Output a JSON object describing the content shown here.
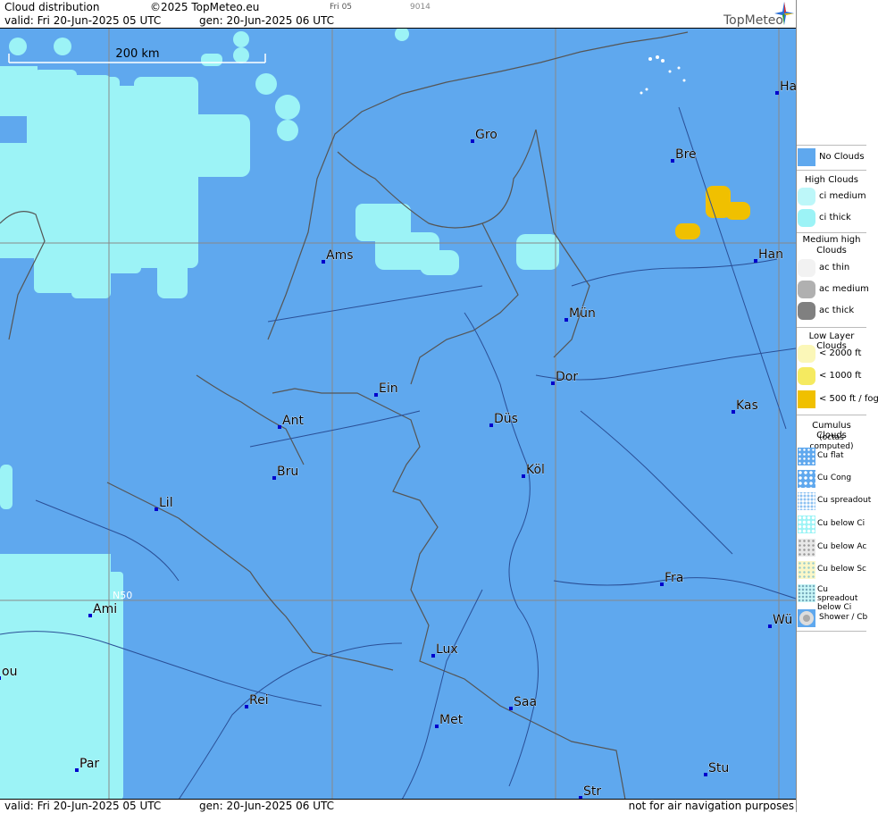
{
  "header": {
    "title": "Cloud distribution",
    "copyright": "©2025 TopMeteo.eu",
    "valid": "valid:  Fri  20-Jun-2025  05 UTC",
    "gen": "gen: 20-Jun-2025 06 UTC",
    "small1": "Fri 05",
    "small2": "9014",
    "brand": "TopMeteo"
  },
  "footer": {
    "valid": "valid:  Fri  20-Jun-2025  05 UTC",
    "gen": "gen: 20-Jun-2025 06 UTC",
    "note": "not for air navigation purposes"
  },
  "map": {
    "scale_label": "200 km",
    "lat_label": "N50",
    "colors": {
      "no_clouds": "#5fa8ee",
      "ci": "#9cf3f6",
      "low_fog": "#f0c000",
      "river": "#2a4f96",
      "grid": "#888888"
    },
    "cities": [
      {
        "name": "Ha"
      },
      {
        "name": "Gro"
      },
      {
        "name": "Bre"
      },
      {
        "name": "Ams"
      },
      {
        "name": "Han"
      },
      {
        "name": "Mün"
      },
      {
        "name": "Ein"
      },
      {
        "name": "Dor"
      },
      {
        "name": "Ant"
      },
      {
        "name": "Düs"
      },
      {
        "name": "Kas"
      },
      {
        "name": "Köl"
      },
      {
        "name": "Bru"
      },
      {
        "name": "Lil"
      },
      {
        "name": "Fra"
      },
      {
        "name": "Ami"
      },
      {
        "name": "Wü"
      },
      {
        "name": "Lux"
      },
      {
        "name": "ou"
      },
      {
        "name": "Rei"
      },
      {
        "name": "Saa"
      },
      {
        "name": "Met"
      },
      {
        "name": "Par"
      },
      {
        "name": "Stu"
      },
      {
        "name": "Str"
      }
    ]
  },
  "legend": {
    "no_clouds": "No Clouds",
    "high_title": "High Clouds",
    "ci_medium": "ci medium",
    "ci_thick": "ci thick",
    "medium_title": "Medium high Clouds",
    "ac_thin": "ac thin",
    "ac_medium": "ac medium",
    "ac_thick": "ac thick",
    "low_title": "Low Layer Clouds",
    "low_2000": "< 2000 ft",
    "low_1000": "< 1000 ft",
    "low_500": "< 500 ft / fog",
    "cu_title": "Cumulus Clouds",
    "cu_sub": "(octas computed)",
    "cu_flat": "Cu flat",
    "cu_cong": "Cu Cong",
    "cu_spread": "Cu spreadout",
    "cu_below_ci": "Cu below Ci",
    "cu_below_ac": "Cu below Ac",
    "cu_below_sc": "Cu below Sc",
    "cu_spread_ci": "Cu spreadout below Ci",
    "shower": "Shower / Cb"
  }
}
